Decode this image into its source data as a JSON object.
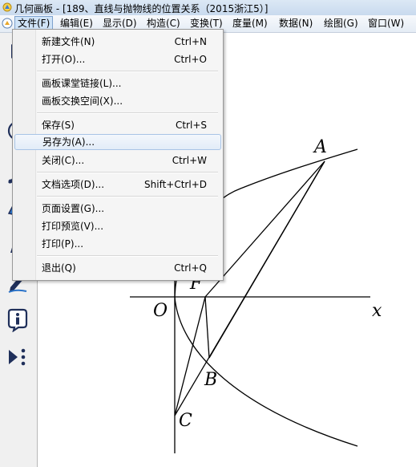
{
  "window": {
    "title": "几何画板 - [189、直线与抛物线的位置关系（2015浙江5）]"
  },
  "menubar": {
    "items": [
      "文件(F)",
      "编辑(E)",
      "显示(D)",
      "构造(C)",
      "变换(T)",
      "度量(M)",
      "数据(N)",
      "绘图(G)",
      "窗口(W)"
    ]
  },
  "file_menu": {
    "new_file": {
      "label": "新建文件(N)",
      "shortcut": "Ctrl+N"
    },
    "open": {
      "label": "打开(O)...",
      "shortcut": "Ctrl+O"
    },
    "board_link": {
      "label": "画板课堂链接(L)..."
    },
    "board_exchange": {
      "label": "画板交换空间(X)..."
    },
    "save": {
      "label": "保存(S)",
      "shortcut": "Ctrl+S"
    },
    "save_as": {
      "label": "另存为(A)..."
    },
    "close": {
      "label": "关闭(C)...",
      "shortcut": "Ctrl+W"
    },
    "doc_options": {
      "label": "文档选项(D)...",
      "shortcut": "Shift+Ctrl+D"
    },
    "page_setup": {
      "label": "页面设置(G)..."
    },
    "print_preview": {
      "label": "打印预览(V)..."
    },
    "print": {
      "label": "打印(P)..."
    },
    "exit": {
      "label": "退出(Q)",
      "shortcut": "Ctrl+Q"
    }
  },
  "toolbar": {
    "tools": [
      "arrow-select-icon",
      "point-tool-icon",
      "compass-circle-icon",
      "straightedge-line-icon",
      "polygon-tool-icon",
      "text-tool-icon",
      "marker-pen-icon",
      "information-icon",
      "custom-tool-icon"
    ]
  },
  "figure": {
    "points": {
      "A": "A",
      "B": "B",
      "C": "C",
      "F": "F",
      "O": "O"
    },
    "axis_x_label": "x"
  }
}
